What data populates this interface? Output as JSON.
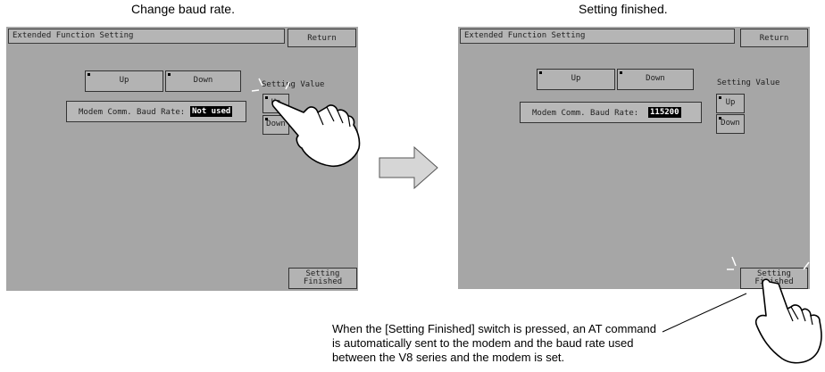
{
  "captions": {
    "left": "Change baud rate.",
    "right": "Setting finished."
  },
  "left_screen": {
    "title": "Extended Function Setting",
    "return_label": "Return",
    "up_label": "Up",
    "down_label": "Down",
    "setting_value_label": "Setting Value",
    "sv_up_label": "Up",
    "sv_down_label": "Down",
    "baud_label": "Modem Comm. Baud Rate:",
    "baud_value": "Not used",
    "finish_line1": "Setting",
    "finish_line2": "Finished"
  },
  "right_screen": {
    "title": "Extended Function Setting",
    "return_label": "Return",
    "up_label": "Up",
    "down_label": "Down",
    "setting_value_label": "Setting Value",
    "sv_up_label": "Up",
    "sv_down_label": "Down",
    "baud_label": "Modem Comm. Baud Rate:",
    "baud_value": "115200",
    "finish_line1": "Setting",
    "finish_line2": "Finished"
  },
  "note": "When the [Setting Finished] switch is pressed, an AT command is automatically sent to the modem and the baud rate used between the V8 series and the modem is set.",
  "colors": {
    "screen_bg": "#a6a6a6",
    "button_bg": "#b3b3b3",
    "arrow_fill": "#d6d6d6"
  }
}
